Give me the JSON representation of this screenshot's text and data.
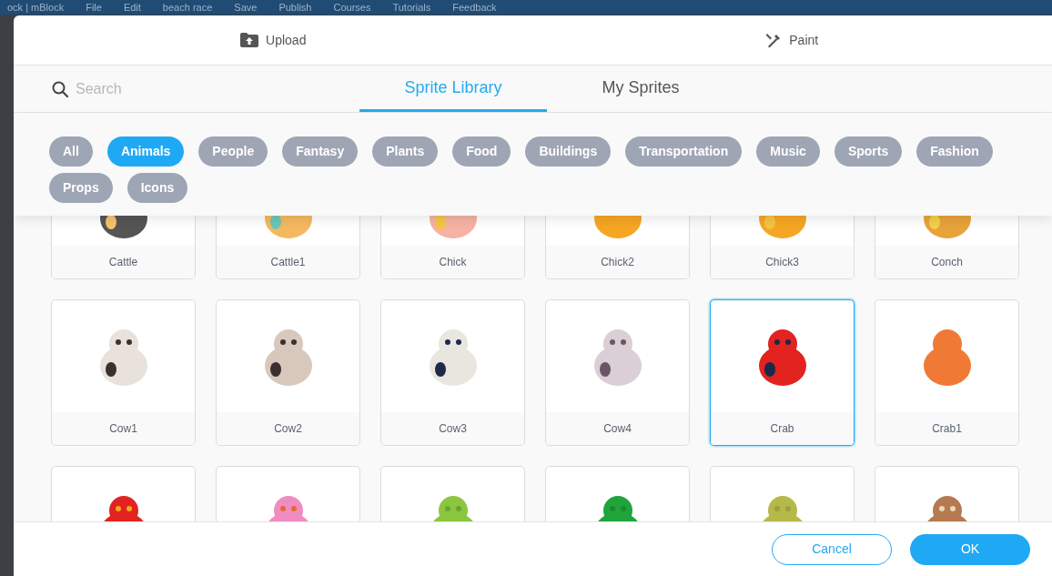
{
  "background_bar": {
    "items": [
      "ock | mBlock",
      "File",
      "Edit",
      "beach race",
      "Save",
      "Publish",
      "Courses",
      "Tutorials",
      "Feedback"
    ]
  },
  "header_tabs": [
    {
      "label": "Upload",
      "kind": "upload"
    },
    {
      "label": "Paint",
      "kind": "paint"
    }
  ],
  "search": {
    "placeholder": "Search"
  },
  "tabs": [
    {
      "label": "Sprite Library",
      "selected": true
    },
    {
      "label": "My Sprites",
      "selected": false
    }
  ],
  "categories": [
    {
      "label": "All",
      "selected": false
    },
    {
      "label": "Animals",
      "selected": true
    },
    {
      "label": "People",
      "selected": false
    },
    {
      "label": "Fantasy",
      "selected": false
    },
    {
      "label": "Plants",
      "selected": false
    },
    {
      "label": "Food",
      "selected": false
    },
    {
      "label": "Buildings",
      "selected": false
    },
    {
      "label": "Transportation",
      "selected": false
    },
    {
      "label": "Music",
      "selected": false
    },
    {
      "label": "Sports",
      "selected": false
    },
    {
      "label": "Fashion",
      "selected": false
    },
    {
      "label": "Props",
      "selected": false
    },
    {
      "label": "Icons",
      "selected": false
    }
  ],
  "sprites": [
    {
      "name": "Cattle",
      "selected": false
    },
    {
      "name": "Cattle1",
      "selected": false
    },
    {
      "name": "Chick",
      "selected": false
    },
    {
      "name": "Chick2",
      "selected": false
    },
    {
      "name": "Chick3",
      "selected": false
    },
    {
      "name": "Conch",
      "selected": false
    },
    {
      "name": "Cow1",
      "selected": false
    },
    {
      "name": "Cow2",
      "selected": false
    },
    {
      "name": "Cow3",
      "selected": false
    },
    {
      "name": "Cow4",
      "selected": false
    },
    {
      "name": "Crab",
      "selected": true
    },
    {
      "name": "Crab1",
      "selected": false
    },
    {
      "selected": false
    },
    {
      "selected": false
    },
    {
      "selected": false
    },
    {
      "selected": false
    },
    {
      "selected": false
    },
    {
      "selected": false
    }
  ],
  "buttons": [
    {
      "label": "Cancel",
      "kind": "secondary"
    },
    {
      "label": "OK",
      "kind": "primary"
    }
  ]
}
